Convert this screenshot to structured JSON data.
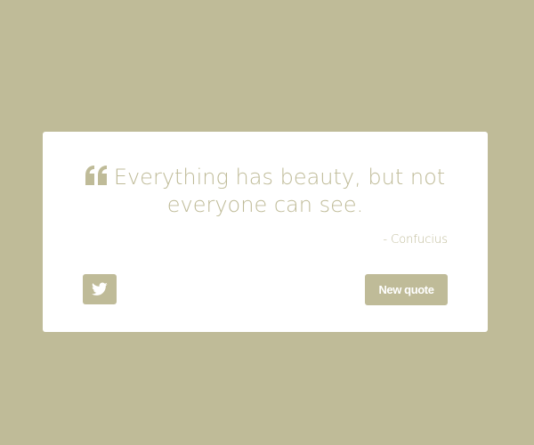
{
  "colors": {
    "background": "#BFBB98",
    "card": "#FFFFFF",
    "accent": "#BFBB98",
    "button_text": "#FFFFFF"
  },
  "quote": {
    "icon": "quote-left-icon",
    "text": "Everything has beauty, but not everyone can see.",
    "author": "- Confucius"
  },
  "actions": {
    "tweet_icon": "twitter-icon",
    "new_quote_label": "New quote"
  }
}
